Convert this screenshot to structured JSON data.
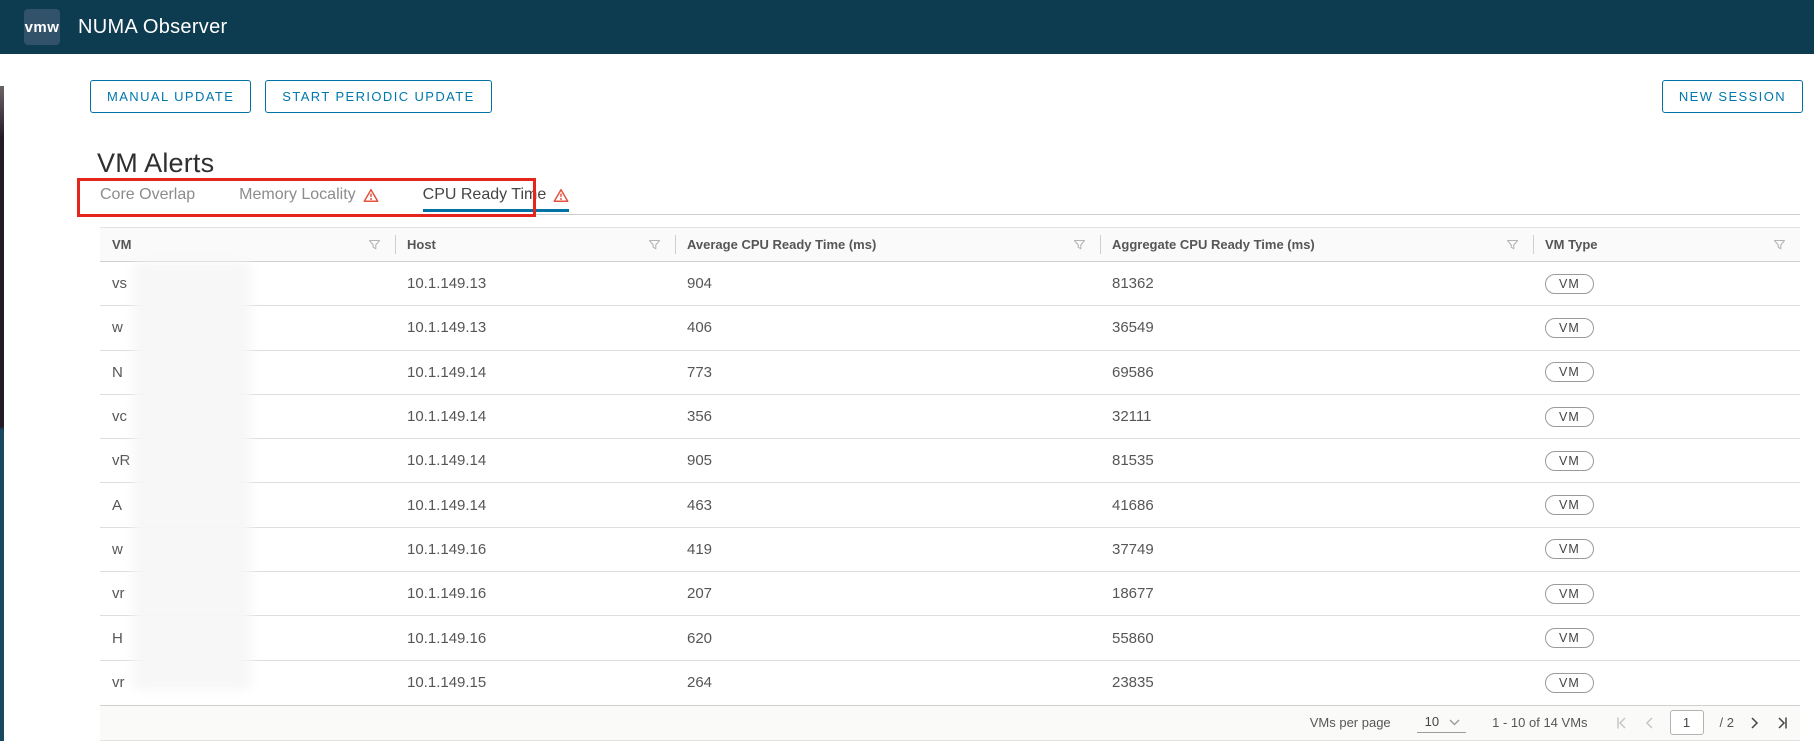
{
  "app": {
    "logo_text": "vmw",
    "title": "NUMA Observer"
  },
  "toolbar": {
    "manual_update_label": "MANUAL UPDATE",
    "start_periodic_update_label": "START PERIODIC UPDATE",
    "new_session_label": "NEW SESSION"
  },
  "section": {
    "title": "VM Alerts"
  },
  "tabs": [
    {
      "label": "Core Overlap",
      "warning": false,
      "active": false
    },
    {
      "label": "Memory Locality",
      "warning": true,
      "active": false
    },
    {
      "label": "CPU Ready Time",
      "warning": true,
      "active": true
    }
  ],
  "table": {
    "columns": [
      "VM",
      "Host",
      "Average CPU Ready Time (ms)",
      "Aggregate CPU Ready Time (ms)",
      "VM Type"
    ],
    "rows": [
      {
        "vm": "vs",
        "host": "10.1.149.13",
        "avg": "904",
        "agg": "81362",
        "type": "VM"
      },
      {
        "vm": "w",
        "host": "10.1.149.13",
        "avg": "406",
        "agg": "36549",
        "type": "VM"
      },
      {
        "vm": "N",
        "host": "10.1.149.14",
        "avg": "773",
        "agg": "69586",
        "type": "VM"
      },
      {
        "vm": "vc",
        "host": "10.1.149.14",
        "avg": "356",
        "agg": "32111",
        "type": "VM"
      },
      {
        "vm": "vR",
        "host": "10.1.149.14",
        "avg": "905",
        "agg": "81535",
        "type": "VM"
      },
      {
        "vm": "A",
        "host": "10.1.149.14",
        "avg": "463",
        "agg": "41686",
        "type": "VM"
      },
      {
        "vm": "w",
        "host": "10.1.149.16",
        "avg": "419",
        "agg": "37749",
        "type": "VM"
      },
      {
        "vm": "vr",
        "host": "10.1.149.16",
        "avg": "207",
        "agg": "18677",
        "type": "VM"
      },
      {
        "vm": "H",
        "host": "10.1.149.16",
        "avg": "620",
        "agg": "55860",
        "type": "VM"
      },
      {
        "vm": "vr",
        "host": "10.1.149.15",
        "avg": "264",
        "agg": "23835",
        "type": "VM"
      }
    ]
  },
  "pagination": {
    "per_page_label": "VMs per page",
    "per_page_value": "10",
    "range_text": "1 - 10 of 14 VMs",
    "current_page": "1",
    "total_pages_text": "/ 2"
  },
  "colors": {
    "appbar_bg": "#0d3c50",
    "action_blue": "#0072a3",
    "warning_orange": "#e5533d",
    "annotation_red": "#e4251c"
  }
}
